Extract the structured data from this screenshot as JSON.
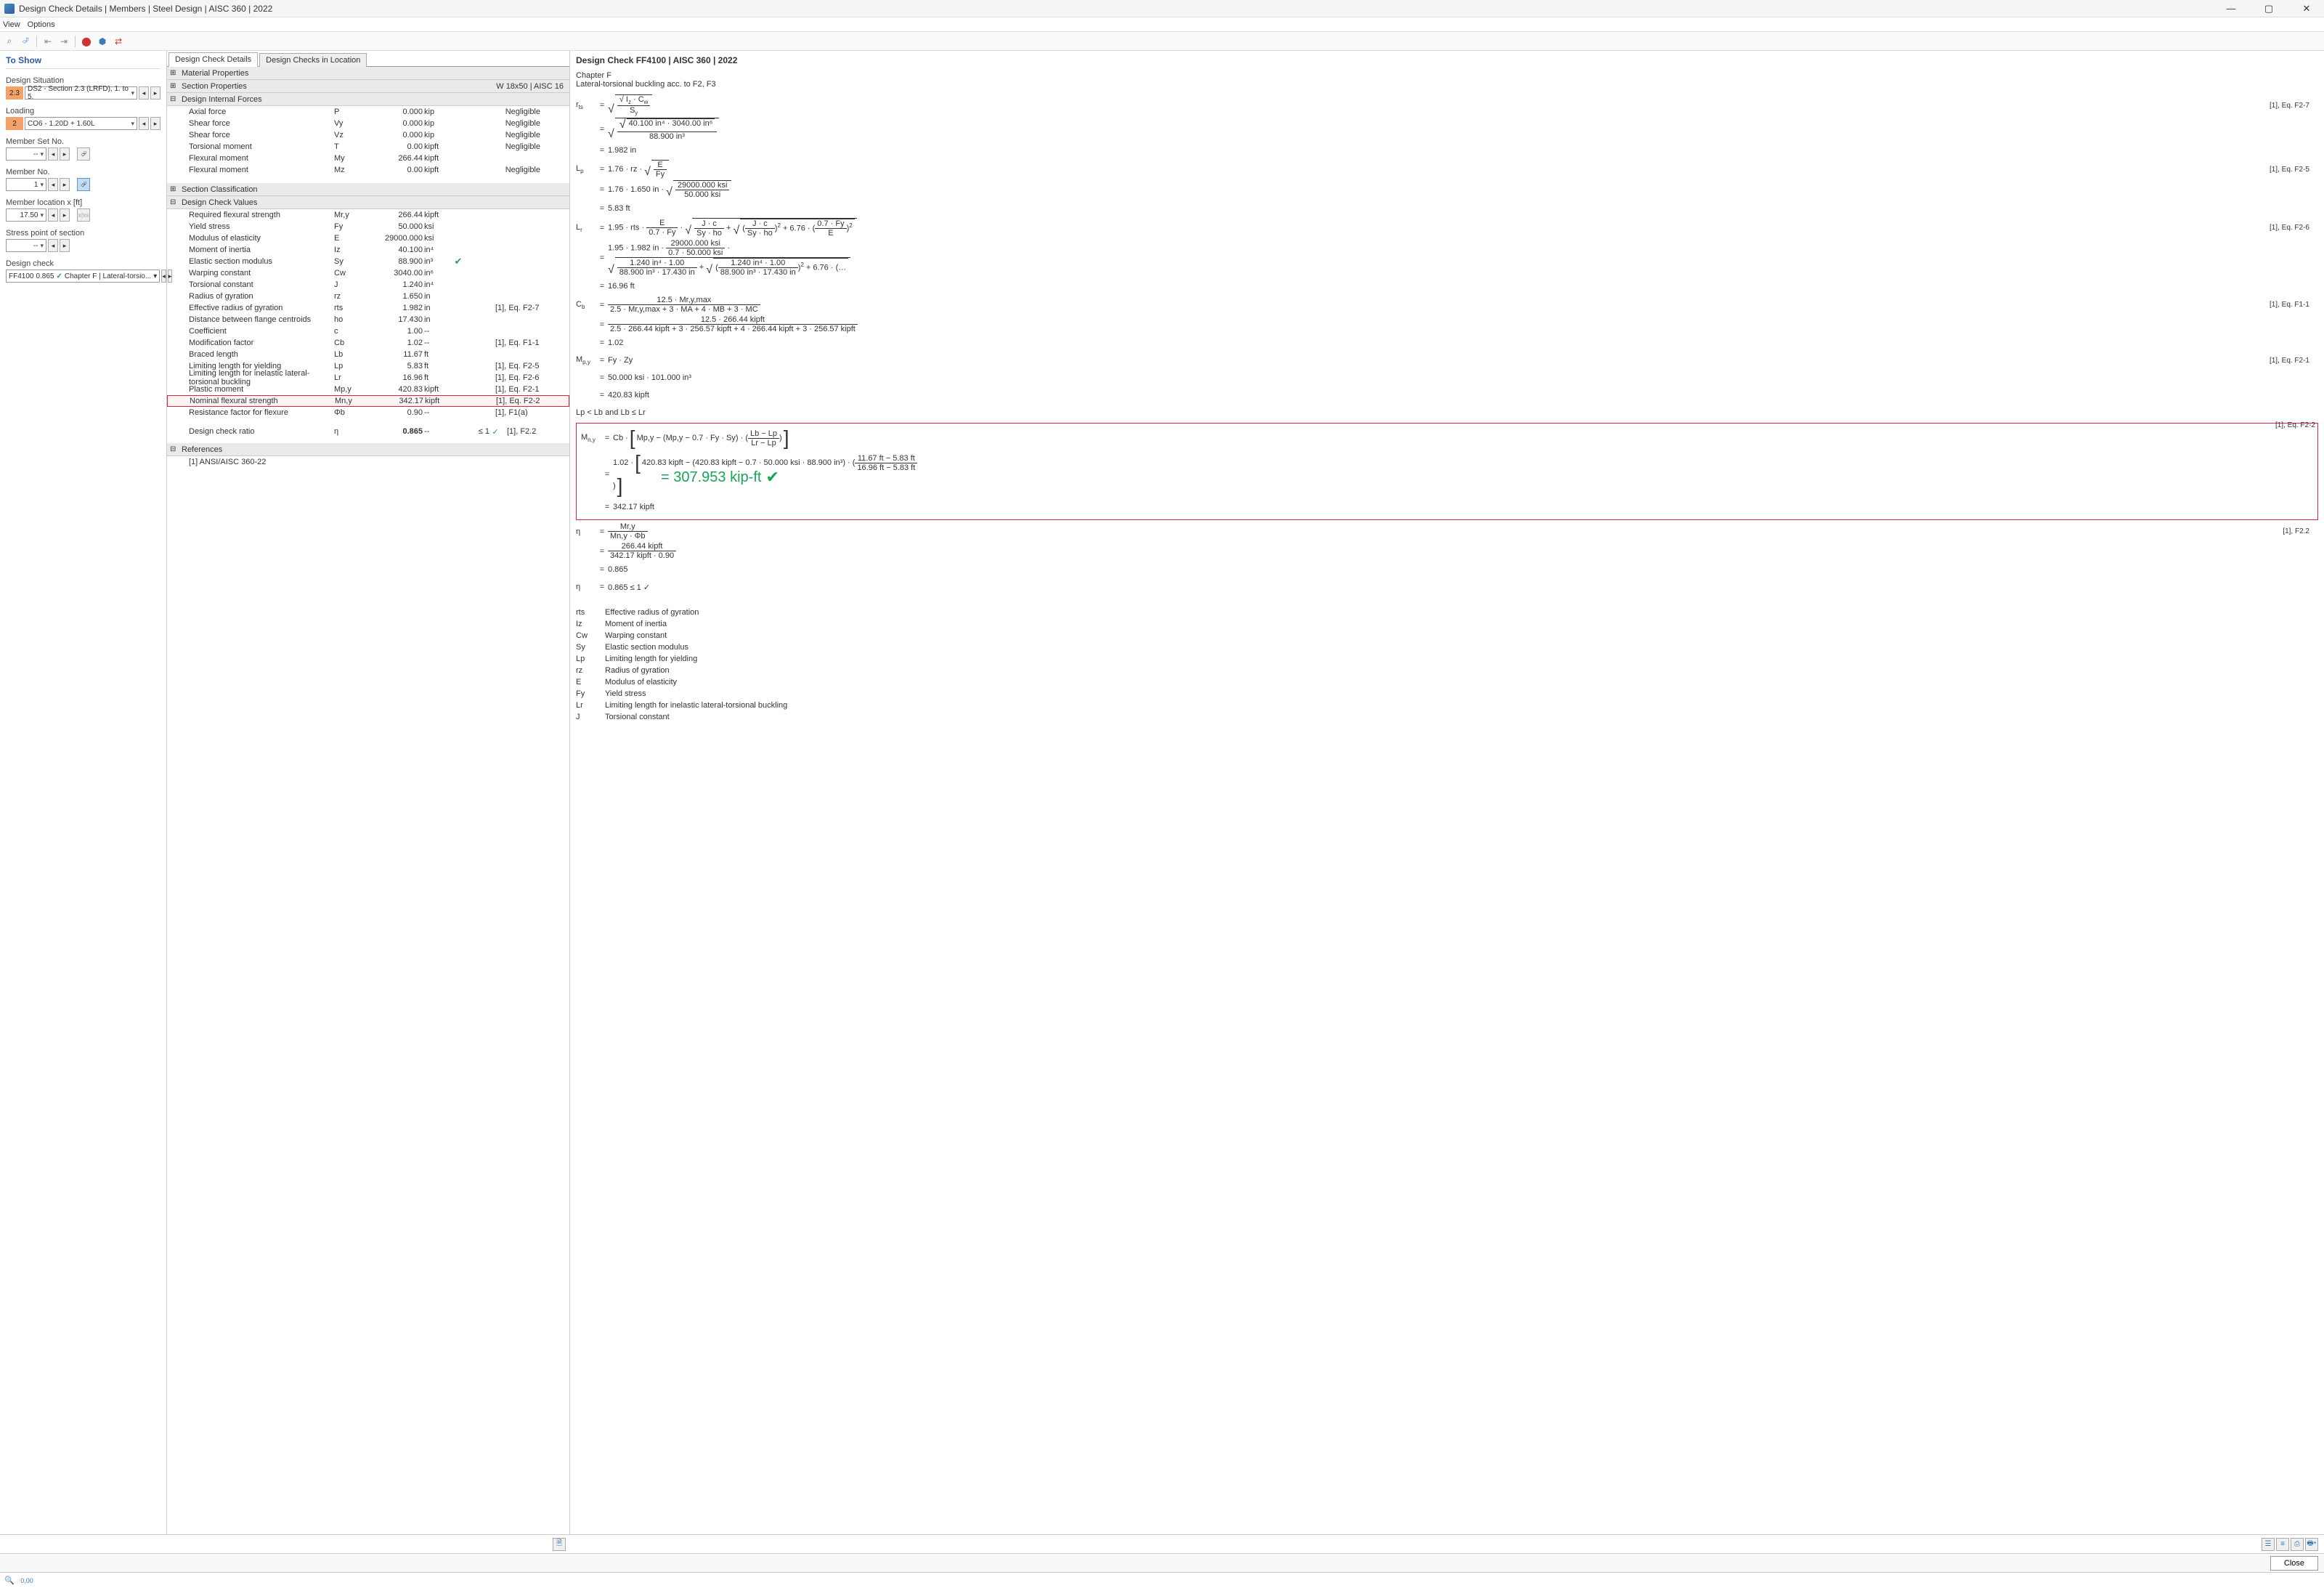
{
  "window": {
    "title": "Design Check Details | Members | Steel Design | AISC 360 | 2022"
  },
  "menu": {
    "view": "View",
    "options": "Options"
  },
  "left": {
    "header": "To Show",
    "design_situation_label": "Design Situation",
    "design_situation_badge": "2.3",
    "design_situation_value": "DS2 - Section 2.3 (LRFD), 1. to 5.",
    "loading_label": "Loading",
    "loading_badge": "2",
    "loading_value": "CO6 - 1.20D + 1.60L",
    "member_set_label": "Member Set No.",
    "member_set_value": "-- ",
    "member_no_label": "Member No.",
    "member_no_value": "1",
    "member_loc_label": "Member location x [ft]",
    "member_loc_value": "17.50",
    "stress_label": "Stress point of section",
    "stress_value": "-- ",
    "design_check_label": "Design check",
    "design_check_code": "FF4100",
    "design_check_ratio": "0.865",
    "design_check_desc": "Chapter F | Lateral-torsio..."
  },
  "tabs": {
    "a": "Design Check Details",
    "b": "Design Checks in Location"
  },
  "sections": {
    "mat": "Material Properties",
    "secprop": "Section Properties",
    "secprop_right": "W 18x50 | AISC 16",
    "dif": "Design Internal Forces",
    "class": "Section Classification",
    "vals": "Design Check Values",
    "refs": "References",
    "ref_item": "[1]   ANSI/AISC 360-22"
  },
  "dif_rows": [
    {
      "lbl": "Axial force",
      "sym": "P",
      "val": "0.000",
      "unit": "kip",
      "ref": "Negligible"
    },
    {
      "lbl": "Shear force",
      "sym": "Vy",
      "val": "0.000",
      "unit": "kip",
      "ref": "Negligible"
    },
    {
      "lbl": "Shear force",
      "sym": "Vz",
      "val": "0.000",
      "unit": "kip",
      "ref": "Negligible"
    },
    {
      "lbl": "Torsional moment",
      "sym": "T",
      "val": "0.00",
      "unit": "kipft",
      "ref": "Negligible"
    },
    {
      "lbl": "Flexural moment",
      "sym": "My",
      "val": "266.44",
      "unit": "kipft",
      "ref": ""
    },
    {
      "lbl": "Flexural moment",
      "sym": "Mz",
      "val": "0.00",
      "unit": "kipft",
      "ref": "Negligible"
    }
  ],
  "val_rows": [
    {
      "lbl": "Required flexural strength",
      "sym": "Mr,y",
      "val": "266.44",
      "unit": "kipft",
      "ref": ""
    },
    {
      "lbl": "Yield stress",
      "sym": "Fy",
      "val": "50.000",
      "unit": "ksi",
      "ref": ""
    },
    {
      "lbl": "Modulus of elasticity",
      "sym": "E",
      "val": "29000.000",
      "unit": "ksi",
      "ref": ""
    },
    {
      "lbl": "Moment of inertia",
      "sym": "Iz",
      "val": "40.100",
      "unit": "in⁴",
      "ref": ""
    },
    {
      "lbl": "Elastic section modulus",
      "sym": "Sy",
      "val": "88.900",
      "unit": "in³",
      "ref": "",
      "tick": true
    },
    {
      "lbl": "Warping constant",
      "sym": "Cw",
      "val": "3040.00",
      "unit": "in⁶",
      "ref": ""
    },
    {
      "lbl": "Torsional constant",
      "sym": "J",
      "val": "1.240",
      "unit": "in⁴",
      "ref": ""
    },
    {
      "lbl": "Radius of gyration",
      "sym": "rz",
      "val": "1.650",
      "unit": "in",
      "ref": ""
    },
    {
      "lbl": "Effective radius of gyration",
      "sym": "rts",
      "val": "1.982",
      "unit": "in",
      "ref": "[1], Eq. F2-7"
    },
    {
      "lbl": "Distance between flange centroids",
      "sym": "ho",
      "val": "17.430",
      "unit": "in",
      "ref": ""
    },
    {
      "lbl": "Coefficient",
      "sym": "c",
      "val": "1.00",
      "unit": "--",
      "ref": ""
    },
    {
      "lbl": "Modification factor",
      "sym": "Cb",
      "val": "1.02",
      "unit": "--",
      "ref": "[1], Eq. F1-1"
    },
    {
      "lbl": "Braced length",
      "sym": "Lb",
      "val": "11.67",
      "unit": "ft",
      "ref": ""
    },
    {
      "lbl": "Limiting length for yielding",
      "sym": "Lp",
      "val": "5.83",
      "unit": "ft",
      "ref": "[1], Eq. F2-5"
    },
    {
      "lbl": "Limiting length for inelastic lateral-torsional buckling",
      "sym": "Lr",
      "val": "16.96",
      "unit": "ft",
      "ref": "[1], Eq. F2-6"
    },
    {
      "lbl": "Plastic moment",
      "sym": "Mp,y",
      "val": "420.83",
      "unit": "kipft",
      "ref": "[1], Eq. F2-1"
    },
    {
      "lbl": "Nominal flexural strength",
      "sym": "Mn,y",
      "val": "342.17",
      "unit": "kipft",
      "ref": "[1], Eq. F2-2",
      "hl": true
    },
    {
      "lbl": "Resistance factor for flexure",
      "sym": "Φb",
      "val": "0.90",
      "unit": "--",
      "ref": "[1], F1(a)"
    }
  ],
  "ratio_row": {
    "lbl": "Design check ratio",
    "sym": "η",
    "val": "0.865",
    "unit": "--",
    "lim": "≤ 1",
    "ref": "[1], F2.2"
  },
  "right": {
    "title": "Design Check FF4100 | AISC 360 | 2022",
    "chapter": "Chapter F",
    "sub": "Lateral-torsional buckling acc. to F2, F3",
    "refs": {
      "f27": "[1], Eq. F2-7",
      "f25": "[1], Eq. F2-5",
      "f26": "[1], Eq. F2-6",
      "f11": "[1], Eq. F1-1",
      "f21": "[1], Eq. F2-1",
      "f22e": "[1], Eq. F2-2",
      "f22": "[1], F2.2"
    },
    "rts_num_sqrt": "40.100 in⁴  ·  3040.00 in⁶",
    "rts_den": "88.900 in³",
    "rts_val": "1.982 in",
    "lp_expr1": "1.76  ·  rz  ·",
    "lp_frac_top": "E",
    "lp_frac_bot": "Fy",
    "lp_expr2": "1.76  ·  1.650 in  ·",
    "lp_frac2_top": "29000.000 ksi",
    "lp_frac2_bot": "50.000 ksi",
    "lp_val": "5.83 ft",
    "lr_lead": "1.95  ·  rts ·",
    "lr_f1_top": "E",
    "lr_f1_bot": "0.7  ·  Fy",
    "lr_f2_top": "J  ·  c",
    "lr_f2_bot": "Sy  ·  ho",
    "lr_f3_top": "0.7  ·  Fy",
    "lr_f3_bot": "E",
    "lr2_lead": "1.95  ·  1.982 in  ·",
    "lr2_f1_top": "29000.000 ksi",
    "lr2_f1_bot": "0.7  ·  50.000 ksi",
    "lr2_f2_top": "1.240 in⁴  ·  1.00",
    "lr2_f2_bot": "88.900 in³  ·  17.430 in",
    "lr_val": "16.96 ft",
    "cb_num": "12.5  ·  Mr,y,max",
    "cb_den": "2.5  ·  Mr,y,max  +  3  ·  MA  +  4  ·  MB  +  3  ·  MC",
    "cb_num2": "12.5  ·  266.44 kipft",
    "cb_den2": "2.5  ·  266.44 kipft  +  3  ·  256.57 kipft  +  4  ·  266.44 kipft  +  3  ·  256.57 kipft",
    "cb_val": "1.02",
    "mp_expr": "Fy  ·  Zy",
    "mp_expr2": "50.000 ksi  ·  101.000 in³",
    "mp_val": "420.83 kipft",
    "cond": "Lp  <  Lb  and  Lb  ≤  Lr",
    "mn_lead": "Cb  ·",
    "mn_inner": "Mp,y  − (Mp,y  − 0.7  ·  Fy  ·  Sy)  ·",
    "mn_frac_top": "Lb  −  Lp",
    "mn_frac_bot": "Lr  −  Lp",
    "mn2_lead": "1.02  ·",
    "mn2_inner": "420.83 kipft  −  (420.83 kipft  −  0.7  ·  50.000 ksi  ·  88.900 in³)  ·",
    "mn2_frac_top": "11.67 ft  − 5.83 ft",
    "mn2_frac_bot": "16.96 ft  − 5.83 ft",
    "mn_val": "342.17 kipft",
    "eta_top": "Mr,y",
    "eta_bot": "Mn,y  ·  Φb",
    "eta2_top": "266.44 kipft",
    "eta2_bot": "342.17 kipft  ·  0.90",
    "eta_val": "0.865",
    "eta_final": "0.865  ≤ 1 ✓",
    "result_tag": "= 307.953 kip-ft"
  },
  "glossary": [
    {
      "s": "rts",
      "t": "Effective radius of gyration"
    },
    {
      "s": "Iz",
      "t": "Moment of inertia"
    },
    {
      "s": "Cw",
      "t": "Warping constant"
    },
    {
      "s": "Sy",
      "t": "Elastic section modulus"
    },
    {
      "s": "Lp",
      "t": "Limiting length for yielding"
    },
    {
      "s": "rz",
      "t": "Radius of gyration"
    },
    {
      "s": "E",
      "t": "Modulus of elasticity"
    },
    {
      "s": "Fy",
      "t": "Yield stress"
    },
    {
      "s": "Lr",
      "t": "Limiting length for inelastic lateral-torsional buckling"
    },
    {
      "s": "J",
      "t": "Torsional constant"
    }
  ],
  "footer": {
    "close": "Close"
  }
}
